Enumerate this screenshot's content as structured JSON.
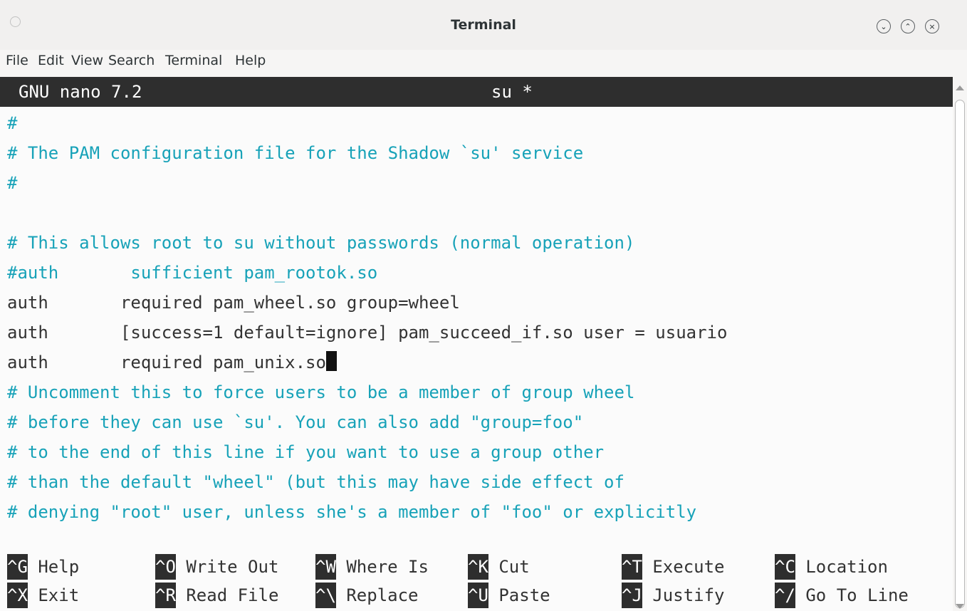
{
  "window": {
    "title": "Terminal",
    "buttons": {
      "minimize": "⌄",
      "maximize": "⌃",
      "close": "×"
    }
  },
  "menu": [
    "File",
    "Edit",
    "View",
    "Search",
    "Terminal",
    "Help"
  ],
  "nano": {
    "version_label": "GNU nano 7.2",
    "file_label": "su *"
  },
  "lines": [
    "#",
    "# The PAM configuration file for the Shadow `su' service",
    "#",
    "",
    "# This allows root to su without passwords (normal operation)",
    "#auth       sufficient pam_rootok.so",
    "auth       required pam_wheel.so group=wheel",
    "auth       [success=1 default=ignore] pam_succeed_if.so user = usuario",
    "auth       required pam_unix.so",
    "# Uncomment this to force users to be a member of group wheel",
    "# before they can use `su'. You can also add \"group=foo\"",
    "# to the end of this line if you want to use a group other",
    "# than the default \"wheel\" (but this may have side effect of",
    "# denying \"root\" user, unless she's a member of \"foo\" or explicitly"
  ],
  "shortcuts": [
    [
      {
        "key": "^G",
        "label": "Help"
      },
      {
        "key": "^O",
        "label": "Write Out"
      },
      {
        "key": "^W",
        "label": "Where Is"
      },
      {
        "key": "^K",
        "label": "Cut"
      },
      {
        "key": "^T",
        "label": "Execute"
      },
      {
        "key": "^C",
        "label": "Location"
      }
    ],
    [
      {
        "key": "^X",
        "label": "Exit"
      },
      {
        "key": "^R",
        "label": "Read File"
      },
      {
        "key": "^\\",
        "label": "Replace"
      },
      {
        "key": "^U",
        "label": "Paste"
      },
      {
        "key": "^J",
        "label": "Justify"
      },
      {
        "key": "^/",
        "label": "Go To Line"
      }
    ]
  ]
}
